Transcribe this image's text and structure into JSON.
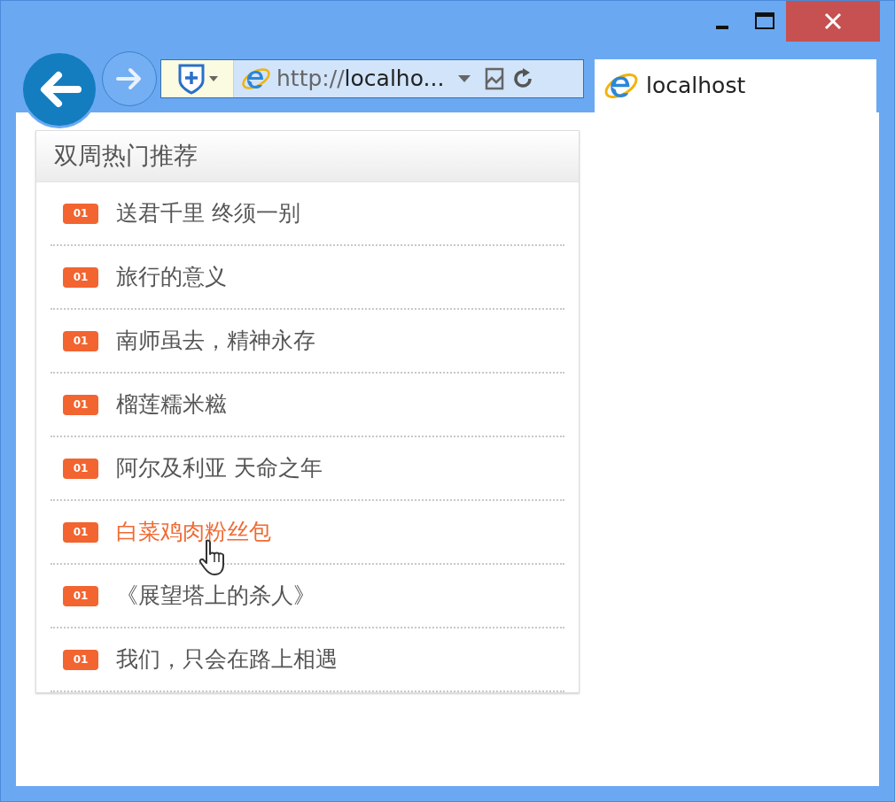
{
  "browser": {
    "url_scheme": "http://",
    "url_host": "localho...",
    "tab_title": "localhost"
  },
  "panel": {
    "title": "双周热门推荐",
    "items": [
      {
        "badge": "01",
        "title": "送君千里 终须一别",
        "hovered": false
      },
      {
        "badge": "01",
        "title": "旅行的意义",
        "hovered": false
      },
      {
        "badge": "01",
        "title": "南师虽去，精神永存",
        "hovered": false
      },
      {
        "badge": "01",
        "title": "榴莲糯米糍",
        "hovered": false
      },
      {
        "badge": "01",
        "title": "阿尔及利亚 天命之年",
        "hovered": false
      },
      {
        "badge": "01",
        "title": "白菜鸡肉粉丝包",
        "hovered": true
      },
      {
        "badge": "01",
        "title": "《展望塔上的杀人》",
        "hovered": false
      },
      {
        "badge": "01",
        "title": "我们，只会在路上相遇",
        "hovered": false
      }
    ]
  }
}
